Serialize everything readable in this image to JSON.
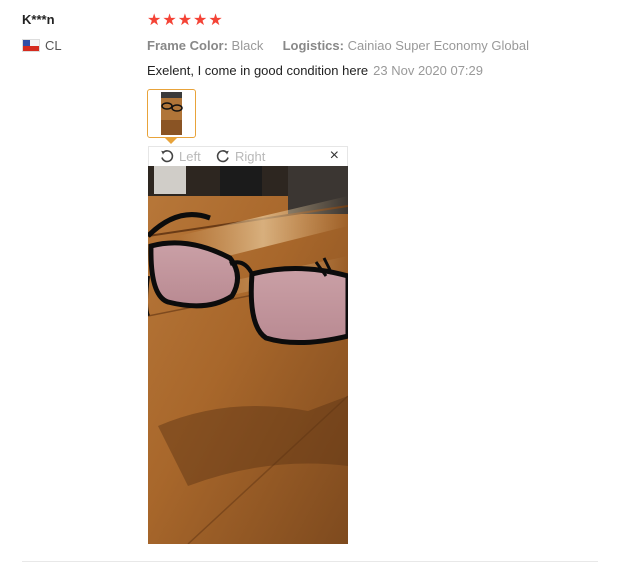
{
  "review": {
    "user_name": "K***n",
    "country_code": "CL",
    "rating": 5,
    "star_glyph": "★",
    "star_color": "#f44336",
    "attributes": [
      {
        "label": "Frame Color:",
        "value": "Black"
      },
      {
        "label": "Logistics:",
        "value": "Cainiao Super Economy Global"
      }
    ],
    "text": "Exelent, I come in good condition here",
    "date": "23 Nov 2020 07:29"
  },
  "viewer": {
    "rotate_left_label": "Left",
    "rotate_right_label": "Right",
    "close_glyph": "×",
    "icons": [
      "rotate-left-icon",
      "rotate-right-icon",
      "close-icon"
    ]
  },
  "colors": {
    "thumb_border": "#e8a33a",
    "muted_text": "#999999"
  }
}
